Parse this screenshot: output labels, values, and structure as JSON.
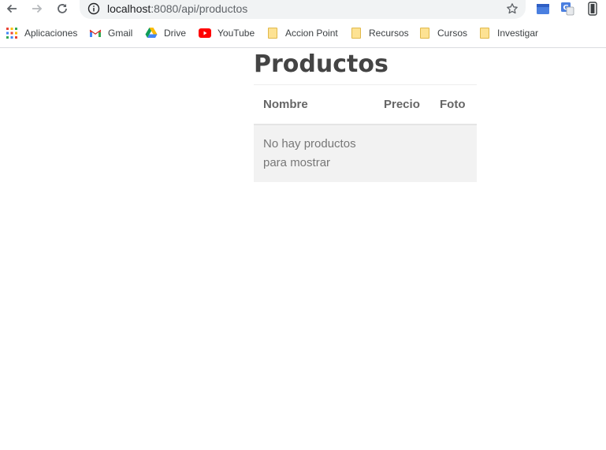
{
  "browser": {
    "url_host": "localhost",
    "url_rest": ":8080/api/productos",
    "bookmarks": [
      {
        "label": "Aplicaciones",
        "icon": "apps-grid-icon"
      },
      {
        "label": "Gmail",
        "icon": "gmail-icon"
      },
      {
        "label": "Drive",
        "icon": "drive-icon"
      },
      {
        "label": "YouTube",
        "icon": "youtube-icon"
      },
      {
        "label": "Accion Point",
        "icon": "folder-icon"
      },
      {
        "label": "Recursos",
        "icon": "folder-icon"
      },
      {
        "label": "Cursos",
        "icon": "folder-icon"
      },
      {
        "label": "Investigar",
        "icon": "folder-icon"
      }
    ]
  },
  "page": {
    "title": "Productos",
    "table": {
      "headers": [
        "Nombre",
        "Precio",
        "Foto"
      ],
      "empty_message": "No hay productos para mostrar"
    }
  }
}
